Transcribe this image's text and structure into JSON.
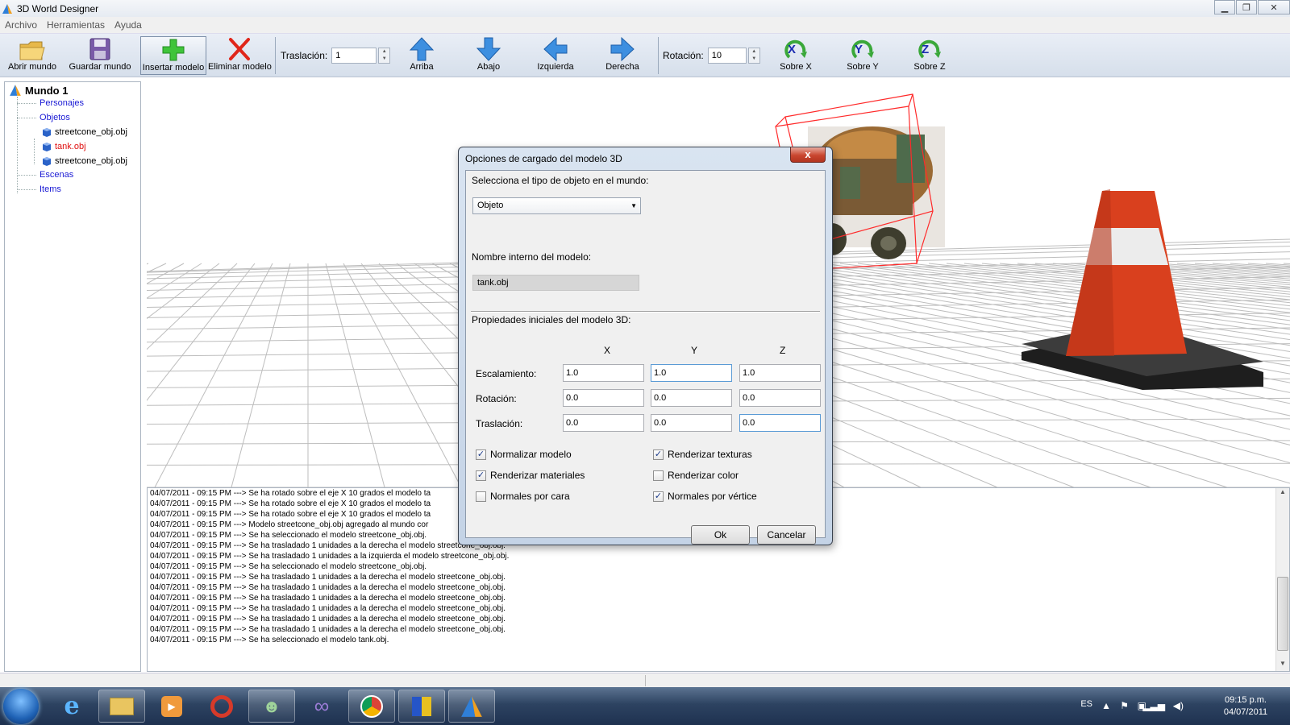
{
  "window": {
    "title": "3D World Designer"
  },
  "menu": [
    "Archivo",
    "Herramientas",
    "Ayuda"
  ],
  "toolbar": {
    "open_label": "Abrir mundo",
    "save_label": "Guardar mundo",
    "insert_label": "Insertar modelo",
    "delete_label": "Eliminar modelo",
    "translation_label": "Traslación:",
    "translation_value": "1",
    "up_label": "Arriba",
    "down_label": "Abajo",
    "left_label": "Izquierda",
    "right_label": "Derecha",
    "rotation_label": "Rotación:",
    "rotation_value": "10",
    "about_x_label": "Sobre X",
    "about_y_label": "Sobre Y",
    "about_z_label": "Sobre Z",
    "axis_x": "X",
    "axis_y": "Y",
    "axis_z": "Z"
  },
  "tree": {
    "root": "Mundo 1",
    "personajes": "Personajes",
    "objetos": "Objetos",
    "obj1": "streetcone_obj.obj",
    "obj2": "tank.obj",
    "obj3": "streetcone_obj.obj",
    "escenas": "Escenas",
    "items": "Items"
  },
  "log": [
    "04/07/2011 - 09:15 PM ---> Se ha rotado sobre el eje X 10 grados el modelo ta",
    "04/07/2011 - 09:15 PM ---> Se ha rotado sobre el eje X 10 grados el modelo ta",
    "04/07/2011 - 09:15 PM ---> Se ha rotado sobre el eje X 10 grados el modelo ta",
    "04/07/2011 - 09:15 PM ---> Modelo streetcone_obj.obj agregado al mundo cor",
    "04/07/2011 - 09:15 PM ---> Se ha seleccionado el modelo streetcone_obj.obj.",
    "04/07/2011 - 09:15 PM ---> Se ha trasladado 1 unidades a la derecha el modelo streetcone_obj.obj.",
    "04/07/2011 - 09:15 PM ---> Se ha trasladado 1 unidades a la izquierda el modelo streetcone_obj.obj.",
    "04/07/2011 - 09:15 PM ---> Se ha seleccionado el modelo streetcone_obj.obj.",
    "04/07/2011 - 09:15 PM ---> Se ha trasladado 1 unidades a la derecha el modelo streetcone_obj.obj.",
    "04/07/2011 - 09:15 PM ---> Se ha trasladado 1 unidades a la derecha el modelo streetcone_obj.obj.",
    "04/07/2011 - 09:15 PM ---> Se ha trasladado 1 unidades a la derecha el modelo streetcone_obj.obj.",
    "04/07/2011 - 09:15 PM ---> Se ha trasladado 1 unidades a la derecha el modelo streetcone_obj.obj.",
    "04/07/2011 - 09:15 PM ---> Se ha trasladado 1 unidades a la derecha el modelo streetcone_obj.obj.",
    "04/07/2011 - 09:15 PM ---> Se ha trasladado 1 unidades a la derecha el modelo streetcone_obj.obj.",
    "04/07/2011 - 09:15 PM ---> Se ha seleccionado el modelo tank.obj."
  ],
  "dialog": {
    "title": "Opciones de cargado del modelo 3D",
    "close": "x",
    "type_label": "Selecciona el tipo de objeto en el mundo:",
    "type_value": "Objeto",
    "name_label": "Nombre interno del modelo:",
    "name_value": "tank.obj",
    "props_label": "Propiedades iniciales del modelo 3D:",
    "col_x": "X",
    "col_y": "Y",
    "col_z": "Z",
    "scale_label": "Escalamiento:",
    "scale": [
      "1.0",
      "1.0",
      "1.0"
    ],
    "rotation_label": "Rotación:",
    "rotation": [
      "0.0",
      "0.0",
      "0.0"
    ],
    "translation_label": "Traslación:",
    "translation": [
      "0.0",
      "0.0",
      "0.0"
    ],
    "cb_normalize": "Normalizar modelo",
    "cb_textures": "Renderizar texturas",
    "cb_materials": "Renderizar materiales",
    "cb_color": "Renderizar color",
    "cb_face_normals": "Normales por cara",
    "cb_vertex_normals": "Normales por vértice",
    "ok": "Ok",
    "cancel": "Cancelar"
  },
  "taskbar": {
    "lang": "ES",
    "time": "09:15 p.m.",
    "date": "04/07/2011"
  }
}
